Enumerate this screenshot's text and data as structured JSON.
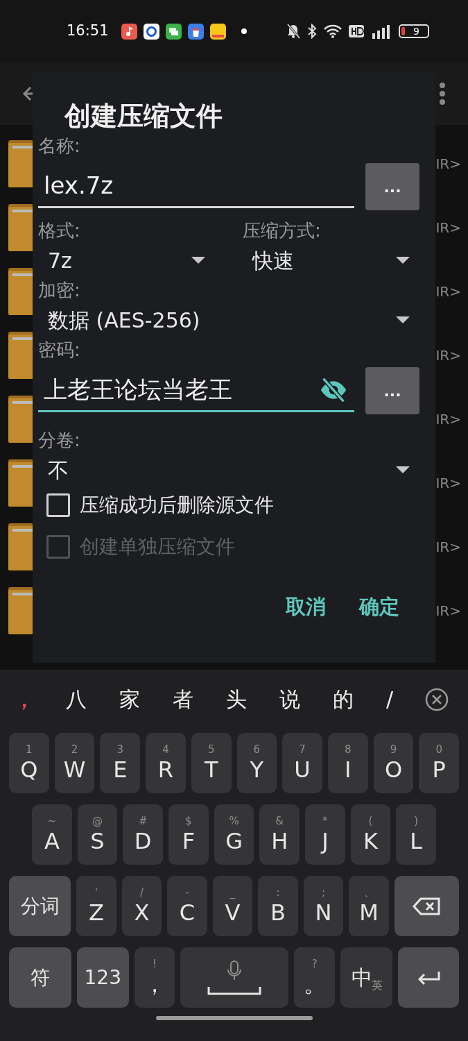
{
  "status_bar": {
    "time": "16:51",
    "battery": "9"
  },
  "background_app": {
    "rows": [
      {
        "tag": "IR>"
      },
      {
        "tag": "IR>"
      },
      {
        "tag": "IR>"
      },
      {
        "tag": "IR>"
      },
      {
        "tag": "IR>"
      },
      {
        "tag": "IR>"
      },
      {
        "tag": "IR>"
      },
      {
        "tag": "IR>"
      }
    ]
  },
  "dialog": {
    "title": "创建压缩文件",
    "name_field": {
      "label": "名称:",
      "value": "lex.7z",
      "focused": false,
      "button": "..."
    },
    "format": {
      "label": "格式:",
      "value": "7z"
    },
    "method": {
      "label": "压缩方式:",
      "value": "快速"
    },
    "encryption": {
      "label": "加密:",
      "value": "数据 (AES-256)"
    },
    "password_field": {
      "label": "密码:",
      "value": "上老王论坛当老王",
      "focused": true,
      "button": "..."
    },
    "split": {
      "label": "分卷:",
      "value": "不"
    },
    "checkboxes": [
      {
        "label": "压缩成功后删除源文件",
        "checked": false,
        "disabled": false
      },
      {
        "label": "创建单独压缩文件",
        "checked": false,
        "disabled": true
      }
    ],
    "buttons": [
      "取消",
      "确定"
    ]
  },
  "keyboard": {
    "candidates": [
      "，",
      "八",
      "家",
      "者",
      "头",
      "说",
      "的",
      "/"
    ],
    "rows": [
      {
        "keys": [
          {
            "kind": "letter",
            "main": "Q",
            "sub": "1"
          },
          {
            "kind": "letter",
            "main": "W",
            "sub": "2"
          },
          {
            "kind": "letter",
            "main": "E",
            "sub": "3"
          },
          {
            "kind": "letter",
            "main": "R",
            "sub": "4"
          },
          {
            "kind": "letter",
            "main": "T",
            "sub": "5"
          },
          {
            "kind": "letter",
            "main": "Y",
            "sub": "6"
          },
          {
            "kind": "letter",
            "main": "U",
            "sub": "7"
          },
          {
            "kind": "letter",
            "main": "I",
            "sub": "8"
          },
          {
            "kind": "letter",
            "main": "O",
            "sub": "9"
          },
          {
            "kind": "letter",
            "main": "P",
            "sub": "0"
          }
        ]
      },
      {
        "keys": [
          {
            "kind": "letter",
            "main": "A",
            "sub": "~"
          },
          {
            "kind": "letter",
            "main": "S",
            "sub": "@"
          },
          {
            "kind": "letter",
            "main": "D",
            "sub": "#"
          },
          {
            "kind": "letter",
            "main": "F",
            "sub": "$"
          },
          {
            "kind": "letter",
            "main": "G",
            "sub": "%"
          },
          {
            "kind": "letter",
            "main": "H",
            "sub": "&"
          },
          {
            "kind": "letter",
            "main": "J",
            "sub": "*"
          },
          {
            "kind": "letter",
            "main": "K",
            "sub": "("
          },
          {
            "kind": "letter",
            "main": "L",
            "sub": ")"
          }
        ]
      },
      {
        "keys": [
          {
            "kind": "function",
            "main": "分词"
          },
          {
            "kind": "letter",
            "main": "Z",
            "sub": "'"
          },
          {
            "kind": "letter",
            "main": "X",
            "sub": "/"
          },
          {
            "kind": "letter",
            "main": "C",
            "sub": "-"
          },
          {
            "kind": "letter",
            "main": "V",
            "sub": "_"
          },
          {
            "kind": "letter",
            "main": "B",
            "sub": ":"
          },
          {
            "kind": "letter",
            "main": "N",
            "sub": ";"
          },
          {
            "kind": "letter",
            "main": "M",
            "sub": "、"
          },
          {
            "kind": "backspace"
          }
        ]
      },
      {
        "keys": [
          {
            "kind": "function",
            "main": "符"
          },
          {
            "kind": "function",
            "main": "123"
          },
          {
            "kind": "letter",
            "main": "，",
            "sub": "!"
          },
          {
            "kind": "space"
          },
          {
            "kind": "letter",
            "main": "。",
            "sub": "?"
          },
          {
            "kind": "lang",
            "main": "中",
            "sub": "英"
          },
          {
            "kind": "enter"
          }
        ]
      }
    ]
  }
}
